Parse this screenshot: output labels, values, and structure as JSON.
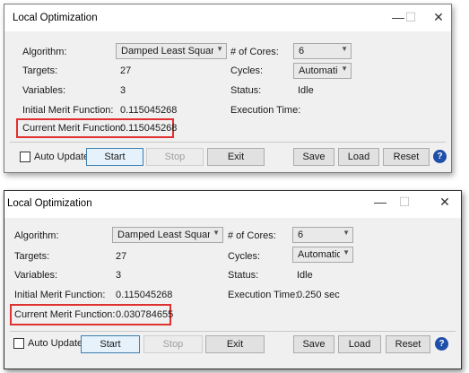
{
  "windows": [
    {
      "title": "Local Optimization",
      "controls": {
        "minimize": "—",
        "maximize": "☐",
        "close": "✕"
      },
      "fields": {
        "algorithm_label": "Algorithm:",
        "algorithm_value": "Damped Least Squares",
        "cores_label": "# of Cores:",
        "cores_value": "6",
        "targets_label": "Targets:",
        "targets_value": "27",
        "cycles_label": "Cycles:",
        "cycles_value": "Automatic",
        "variables_label": "Variables:",
        "variables_value": "3",
        "status_label": "Status:",
        "status_value": "Idle",
        "initial_mf_label": "Initial Merit Function:",
        "initial_mf_value": "0.115045268",
        "exec_time_label": "Execution Time:",
        "exec_time_value": "",
        "current_mf_label": "Current Merit Function:",
        "current_mf_value": "0.115045268"
      },
      "buttons": {
        "auto_update": "Auto Update",
        "start": "Start",
        "stop": "Stop",
        "exit": "Exit",
        "save": "Save",
        "load": "Load",
        "reset": "Reset",
        "help": "?"
      },
      "highlight_color": "#e03030"
    },
    {
      "title": "Local Optimization",
      "controls": {
        "minimize": "—",
        "maximize": "☐",
        "close": "✕"
      },
      "fields": {
        "algorithm_label": "Algorithm:",
        "algorithm_value": "Damped Least Squares",
        "cores_label": "# of Cores:",
        "cores_value": "6",
        "targets_label": "Targets:",
        "targets_value": "27",
        "cycles_label": "Cycles:",
        "cycles_value": "Automatic",
        "variables_label": "Variables:",
        "variables_value": "3",
        "status_label": "Status:",
        "status_value": "Idle",
        "initial_mf_label": "Initial Merit Function:",
        "initial_mf_value": "0.115045268",
        "exec_time_label": "Execution Time:",
        "exec_time_value": "0.250 sec",
        "current_mf_label": "Current Merit Function:",
        "current_mf_value": "0.030784655"
      },
      "buttons": {
        "auto_update": "Auto Update",
        "start": "Start",
        "stop": "Stop",
        "exit": "Exit",
        "save": "Save",
        "load": "Load",
        "reset": "Reset",
        "help": "?"
      },
      "highlight_color": "#e03030"
    }
  ]
}
